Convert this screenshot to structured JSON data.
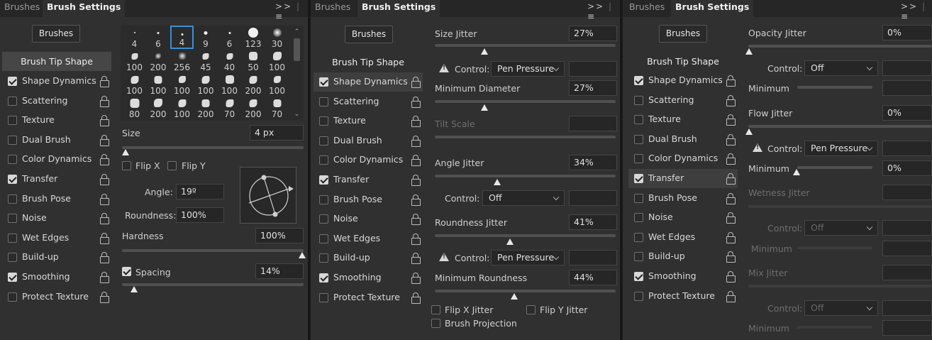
{
  "tabs": {
    "brushes": "Brushes",
    "settings": "Brush Settings"
  },
  "toolbar": {
    "collapse": ">>",
    "menu": "≡"
  },
  "brushes_button": "Brushes",
  "sidebar": {
    "tip": "Brush Tip Shape",
    "items": [
      {
        "label": "Shape Dynamics",
        "checked": true
      },
      {
        "label": "Scattering",
        "checked": false
      },
      {
        "label": "Texture",
        "checked": false
      },
      {
        "label": "Dual Brush",
        "checked": false
      },
      {
        "label": "Color Dynamics",
        "checked": false
      },
      {
        "label": "Transfer",
        "checked": true
      },
      {
        "label": "Brush Pose",
        "checked": false
      },
      {
        "label": "Noise",
        "checked": false
      },
      {
        "label": "Wet Edges",
        "checked": false
      },
      {
        "label": "Build-up",
        "checked": false
      },
      {
        "label": "Smoothing",
        "checked": true
      },
      {
        "label": "Protect Texture",
        "checked": false
      }
    ]
  },
  "panel1": {
    "grid": [
      "4",
      "6",
      "4",
      "9",
      "6",
      "123",
      "30",
      "100",
      "200",
      "256",
      "45",
      "40",
      "50",
      "100",
      "100",
      "100",
      "100",
      "100",
      "100",
      "200",
      "100",
      "80",
      "200",
      "100",
      "200",
      "70",
      "200",
      "70"
    ],
    "size_label": "Size",
    "size_value": "4 px",
    "flip_x": "Flip X",
    "flip_y": "Flip Y",
    "angle_label": "Angle:",
    "angle_value": "19º",
    "roundness_label": "Roundness:",
    "roundness_value": "100%",
    "hardness_label": "Hardness",
    "hardness_value": "100%",
    "spacing_label": "Spacing",
    "spacing_value": "14%"
  },
  "panel2": {
    "size_jitter": "Size Jitter",
    "size_jitter_value": "27%",
    "control": "Control:",
    "pen_pressure": "Pen Pressure",
    "off": "Off",
    "min_diameter": "Minimum Diameter",
    "min_diameter_value": "27%",
    "tilt_scale": "Tilt Scale",
    "angle_jitter": "Angle Jitter",
    "angle_jitter_value": "34%",
    "roundness_jitter": "Roundness Jitter",
    "roundness_jitter_value": "41%",
    "min_roundness": "Minimum Roundness",
    "min_roundness_value": "44%",
    "flip_x_jitter": "Flip X Jitter",
    "flip_y_jitter": "Flip Y Jitter",
    "brush_projection": "Brush Projection"
  },
  "panel3": {
    "opacity_jitter": "Opacity Jitter",
    "opacity_jitter_value": "0%",
    "control": "Control:",
    "off": "Off",
    "pen_pressure": "Pen Pressure",
    "minimum": "Minimum",
    "minimum_value": "0%",
    "flow_jitter": "Flow Jitter",
    "flow_jitter_value": "0%",
    "wetness_jitter": "Wetness Jitter",
    "mix_jitter": "Mix Jitter"
  }
}
